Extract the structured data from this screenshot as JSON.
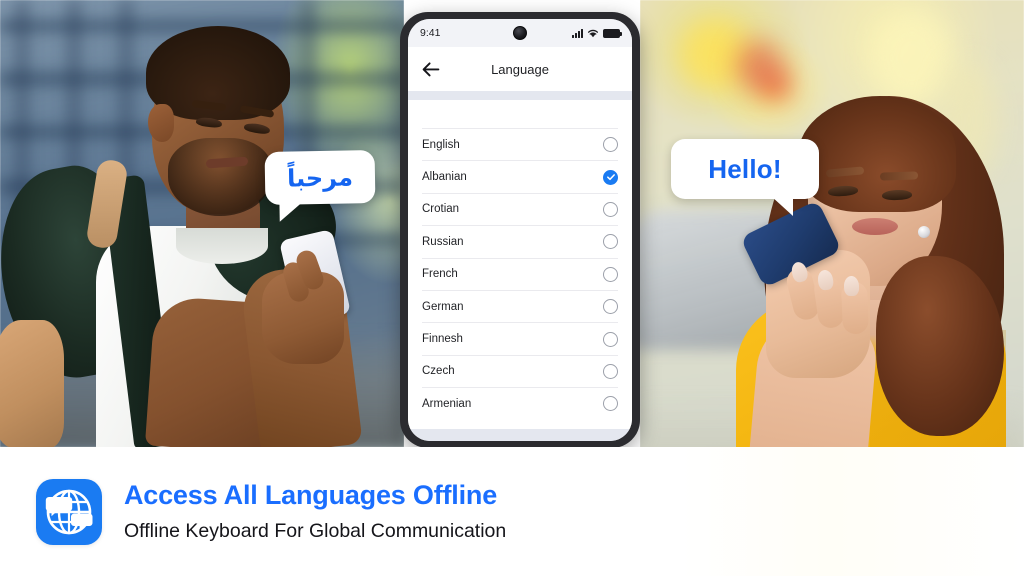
{
  "phone": {
    "status_bar": {
      "time": "9:41",
      "icons": [
        "signal-bars-icon",
        "wifi-icon",
        "battery-icon"
      ],
      "camera": "front-camera-punch-hole"
    },
    "app_bar": {
      "back_icon": "back-arrow-icon",
      "title": "Language"
    },
    "language_list": [
      {
        "name": "English",
        "selected": false
      },
      {
        "name": "Albanian",
        "selected": true
      },
      {
        "name": "Crotian",
        "selected": false
      },
      {
        "name": "Russian",
        "selected": false
      },
      {
        "name": "French",
        "selected": false
      },
      {
        "name": "German",
        "selected": false
      },
      {
        "name": "Finnesh",
        "selected": false
      },
      {
        "name": "Czech",
        "selected": false
      },
      {
        "name": "Armenian",
        "selected": false
      }
    ]
  },
  "bubbles": {
    "left": {
      "text": "مرحباً",
      "language": "arabic"
    },
    "right": {
      "text": "Hello!",
      "language": "english"
    }
  },
  "banner": {
    "icon": "globe-chat-app-icon",
    "title": "Access All Languages Offline",
    "subtitle": "Offline Keyboard For Global Communication"
  },
  "colors": {
    "accent_blue": "#1a7bf2",
    "title_blue": "#1a6eff",
    "bubble_text": "#1565f0",
    "strip_gray": "#e4e7ef",
    "shirt_yellow": "#f5b813"
  }
}
